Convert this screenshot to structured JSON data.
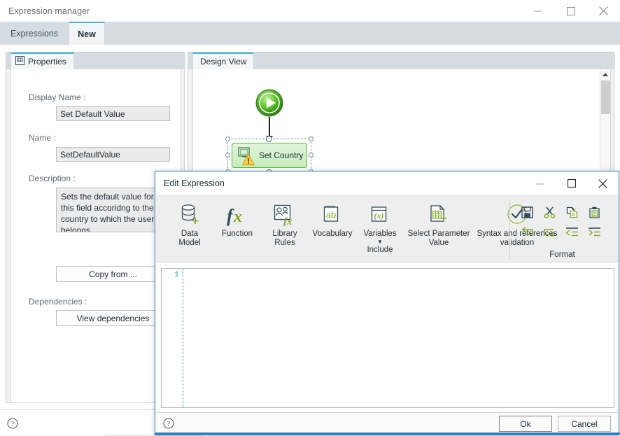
{
  "window": {
    "title": "Expression manager",
    "controls": {
      "minimize": "minimize-button",
      "maximize": "maximize-button",
      "close": "close-button"
    }
  },
  "tabs": [
    {
      "id": "expressions",
      "label": "Expressions",
      "active": false
    },
    {
      "id": "new",
      "label": "New",
      "active": true
    }
  ],
  "properties_panel": {
    "tab_label": "Properties",
    "tab_icon": "properties-icon",
    "fields": {
      "display_name_label": "Display Name :",
      "display_name_value": "Set Default Value",
      "name_label": "Name :",
      "name_value": "SetDefaultValue",
      "description_label": "Description :",
      "description_value": "Sets the default value for this field accoridng to the country to which the user belongs",
      "copy_from_label": "Copy from ...",
      "dependencies_label": "Dependencies :",
      "view_dependencies_label": "View dependencies"
    }
  },
  "design_view": {
    "tab_label": "Design View",
    "nodes": [
      {
        "id": "start",
        "type": "start-node",
        "label": ""
      },
      {
        "id": "set-country",
        "type": "task-node",
        "label": "Set Country",
        "selected": true,
        "warning": true
      }
    ]
  },
  "dialog": {
    "title": "Edit Expression",
    "controls": {
      "minimize": "minimize-button",
      "maximize": "maximize-button",
      "close": "close-button"
    },
    "ribbon": {
      "items": [
        {
          "id": "data-model",
          "icon": "database-add-icon",
          "line1": "Data",
          "line2": "Model"
        },
        {
          "id": "function",
          "icon": "fx-icon",
          "line1": "Function",
          "line2": ""
        },
        {
          "id": "library-rules",
          "icon": "library-rules-icon",
          "line1": "Library",
          "line2": "Rules"
        },
        {
          "id": "vocabulary",
          "icon": "vocabulary-ab-icon",
          "line1": "Vocabulary",
          "line2": ""
        },
        {
          "id": "variables",
          "icon": "variables-x-icon",
          "line1": "Variables",
          "line2": "",
          "has_caret": true
        },
        {
          "id": "select-parameter-value",
          "icon": "table-add-icon",
          "line1": "Select Parameter",
          "line2": "Value"
        },
        {
          "id": "syntax-validation",
          "icon": "check-circle-icon",
          "line1": "Syntax and references",
          "line2": "validation"
        }
      ],
      "include_group_label": "Include",
      "format_group_label": "Format",
      "format_buttons": [
        {
          "id": "save",
          "icon": "save-floppy-icon"
        },
        {
          "id": "cut",
          "icon": "scissors-icon"
        },
        {
          "id": "copy",
          "icon": "copy-icon"
        },
        {
          "id": "paste",
          "icon": "paste-icon"
        },
        {
          "id": "undo",
          "icon": "undo-arrow-icon"
        },
        {
          "id": "redo",
          "icon": "redo-arrow-icon"
        },
        {
          "id": "outdent",
          "icon": "decrease-indent-icon"
        },
        {
          "id": "indent",
          "icon": "increase-indent-icon"
        }
      ]
    },
    "editor": {
      "line_numbers": [
        "1"
      ],
      "content": "",
      "placeholder": ""
    },
    "footer": {
      "help_icon": "help-icon",
      "ok_label": "Ok",
      "cancel_label": "Cancel"
    }
  },
  "statusbar": {
    "help_icon": "help-icon"
  },
  "colors": {
    "accent_blue": "#2a7fc9",
    "tab_accent": "#4ab3d1",
    "tabstrip_bg": "#d6dde2",
    "ribbon_bg": "#eeeeee",
    "icon_dark": "#2e4a5c",
    "icon_green": "#7fa827",
    "node_green_border": "#5fae50",
    "gutter_blue": "#1397c8"
  }
}
